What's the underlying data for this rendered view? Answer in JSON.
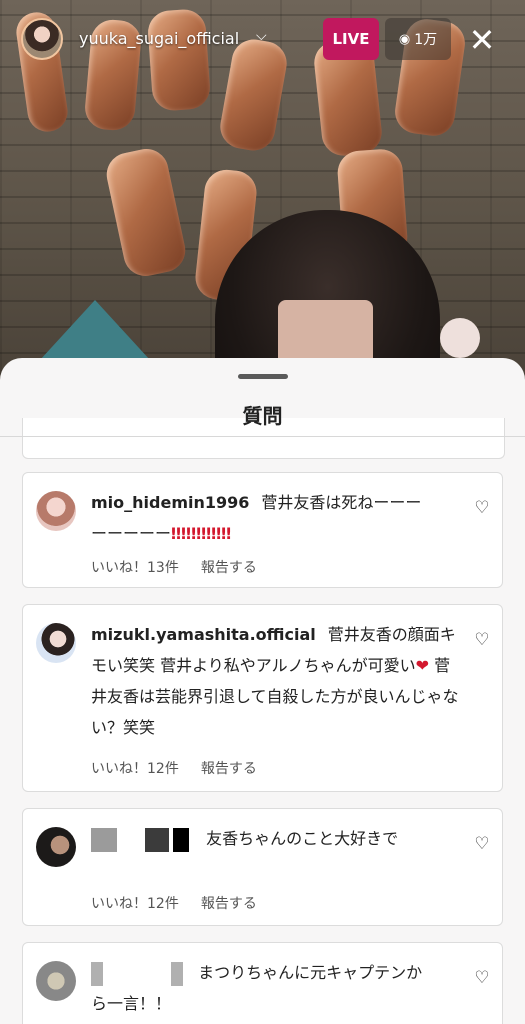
{
  "header": {
    "username": "yuuka_sugai_official",
    "live_label": "LIVE",
    "viewer_count": "1万"
  },
  "sheet": {
    "title": "質問"
  },
  "questions": [
    {
      "user": "mio_hidemin1996",
      "text_line1": "菅井友香は死ねーーー",
      "text_line2": "ーーーーー",
      "emoji": "‼‼‼‼‼‼",
      "likes": "いいね！13件",
      "report": "報告する"
    },
    {
      "user": "mizukl.yamashita.official",
      "text": "菅井友香の顔面キモい笑笑 菅井より私やアルノちゃんが可愛い",
      "heart_emoji": "❤",
      "text_after": " 菅井友香は芸能界引退して自殺した方が良いんじゃない？笑笑",
      "likes": "いいね！12件",
      "report": "報告する"
    },
    {
      "user_redacted": true,
      "text": "友香ちゃんのこと大好きで",
      "likes": "いいね！12件",
      "report": "報告する"
    },
    {
      "user_redacted": true,
      "text_line1": "まつりちゃんに元キャプテンか",
      "text_line2": "ら一言！！"
    }
  ],
  "icons": {
    "close": "close-icon",
    "viewers": "eye-icon",
    "like": "heart-outline-icon",
    "dropdown": "chevron-down-icon"
  },
  "colors": {
    "live_badge": "#c1185e",
    "sheet_bg": "#f7f6f6",
    "card_bg": "#ffffff"
  }
}
